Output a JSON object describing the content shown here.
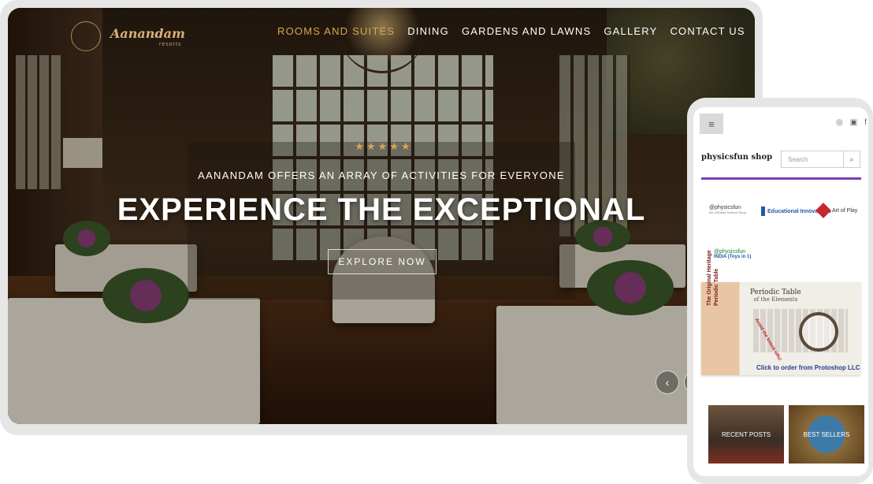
{
  "desktop": {
    "logo": {
      "text": "Aanandam",
      "sub": "resorts"
    },
    "nav": [
      {
        "label": "ROOMS AND SUITES",
        "active": true
      },
      {
        "label": "DINING",
        "active": false
      },
      {
        "label": "GARDENS AND LAWNS",
        "active": false
      },
      {
        "label": "GALLERY",
        "active": false
      },
      {
        "label": "CONTACT US",
        "active": false
      }
    ],
    "hero": {
      "stars": "★★★★★",
      "tagline": "AANANDAM OFFERS AN ARRAY OF ACTIVITIES FOR EVERYONE",
      "headline": "EXPERIENCE THE EXCEPTIONAL",
      "cta": "EXPLORE NOW"
    },
    "slider": {
      "prev_icon": "‹",
      "next_icon": "›"
    },
    "colors": {
      "accent": "#d8a552"
    }
  },
  "mobile": {
    "menu_icon": "≡",
    "social_icons": [
      "instagram-icon",
      "youtube-icon",
      "facebook-icon"
    ],
    "social_glyphs": {
      "instagram": "◎",
      "youtube": "▣",
      "facebook": "f"
    },
    "shop_name": "physicsfun shop",
    "search": {
      "placeholder": "Search",
      "icon": "⌕"
    },
    "brands": [
      {
        "name": "@physicsfun",
        "sub": "the 24Small Science Shop"
      },
      {
        "name": "Educational Innovations"
      },
      {
        "name": "Art of Play"
      },
      {
        "name": "@physicsfun",
        "sub": "INDIA (Toys in 1)"
      }
    ],
    "banner": {
      "side_text": "The Original Heritage Periodic Table",
      "title": "Periodic Table",
      "title_sub": "of the Elements",
      "note": "Avoid the knock-offs!",
      "cta": "Click to order from Protoshop LLC"
    },
    "tiles": [
      {
        "label": "RECENT POSTS"
      },
      {
        "label": "BEST SELLERS"
      }
    ],
    "colors": {
      "divider": "#7a3fb4"
    }
  }
}
